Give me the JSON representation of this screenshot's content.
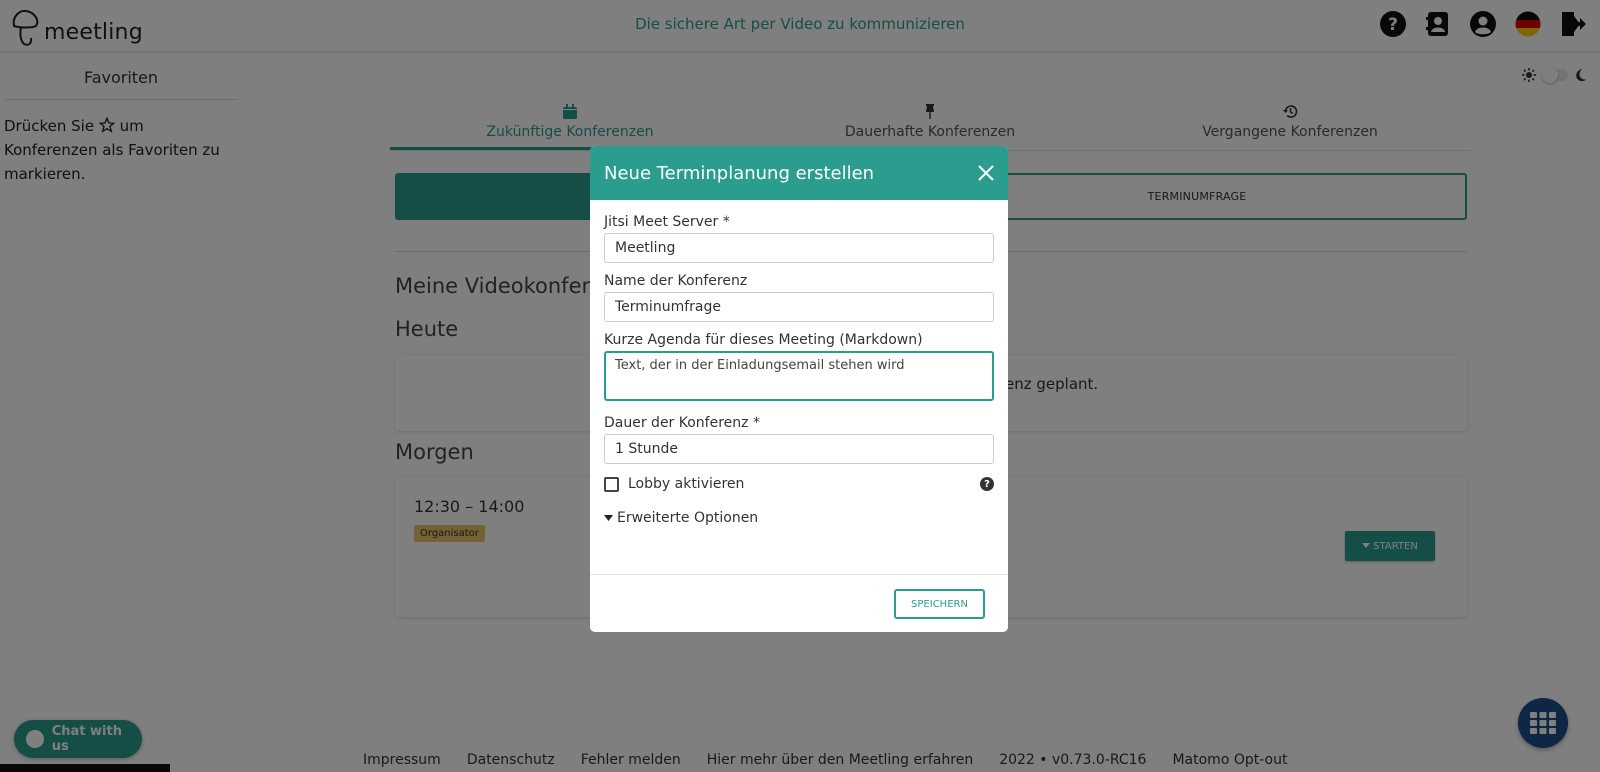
{
  "header": {
    "logo_text": "meetling",
    "tagline": "Die sichere Art per Video zu kommunizieren",
    "icons": [
      "help-icon",
      "contacts-icon",
      "account-icon",
      "german-flag-icon",
      "logout-icon"
    ]
  },
  "sidebar": {
    "title": "Favoriten",
    "hint_before": "Drücken Sie",
    "hint_after": "um Konferenzen als Favoriten zu markieren."
  },
  "tabs": [
    {
      "label": "Zukünftige Konferenzen",
      "icon": "calendar-icon",
      "active": true
    },
    {
      "label": "Dauerhafte Konferenzen",
      "icon": "pin-icon",
      "active": false
    },
    {
      "label": "Vergangene Konferenzen",
      "icon": "history-icon",
      "active": false
    }
  ],
  "main": {
    "poll_button": "TERMINUMFRAGE",
    "my_conferences": "Meine Videokonfere",
    "today": "Heute",
    "today_empty_text": "enz geplant.",
    "tomorrow": "Morgen",
    "meeting_time": "12:30 – 14:00",
    "organizer_badge": "Organisator",
    "start_button": "STARTEN"
  },
  "modal": {
    "title": "Neue Terminplanung erstellen",
    "server_label": "Jitsi Meet Server *",
    "server_value": "Meetling",
    "name_label": "Name der Konferenz",
    "name_value": "Terminumfrage",
    "agenda_label": "Kurze Agenda für dieses Meeting (Markdown)",
    "agenda_value": "Text, der in der Einladungsemail stehen wird",
    "duration_label": "Dauer der Konferenz *",
    "duration_value": "1 Stunde",
    "lobby_label": "Lobby aktivieren",
    "advanced_label": "Erweiterte Optionen",
    "save_button": "SPEICHERN"
  },
  "footer": {
    "links": [
      "Impressum",
      "Datenschutz",
      "Fehler melden",
      "Hier mehr über den Meetling erfahren",
      "2022 • v0.73.0-RC16",
      "Matomo Opt-out"
    ]
  },
  "chat": {
    "label": "Chat with us"
  },
  "colors": {
    "accent": "#2a9d8f",
    "badge": "#e9c46a",
    "apps_button": "#1d4e89"
  }
}
